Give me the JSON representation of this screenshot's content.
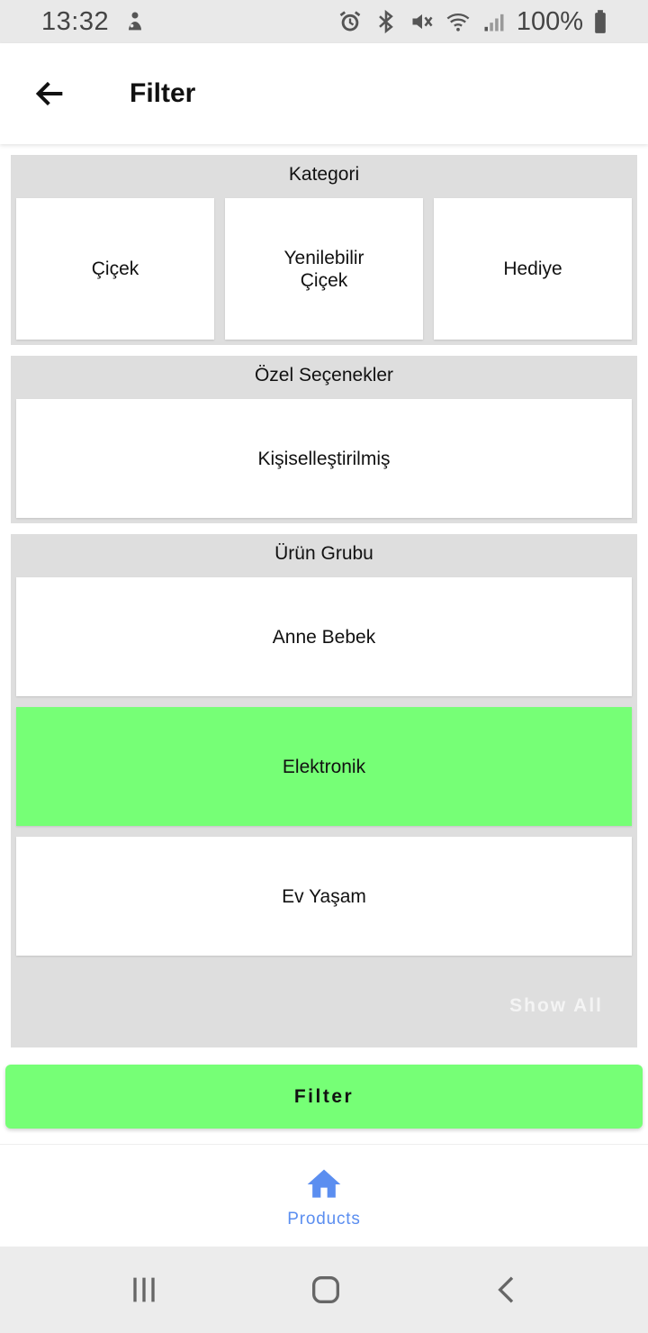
{
  "status_bar": {
    "time": "13:32",
    "battery": "100%",
    "icons": [
      "notification-icon",
      "alarm-icon",
      "bluetooth-icon",
      "vibrate-mute-icon",
      "wifi-icon",
      "signal-icon",
      "battery-icon"
    ]
  },
  "app_bar": {
    "title": "Filter",
    "back_icon": "arrow-back-icon"
  },
  "sections": {
    "kategori": {
      "title": "Kategori",
      "options": [
        "Çiçek",
        "Yenilebilir\nÇiçek",
        "Hediye"
      ]
    },
    "ozel": {
      "title": "Özel Seçenekler",
      "options": [
        "Kişiselleştirilmiş"
      ]
    },
    "urun": {
      "title": "Ürün Grubu",
      "options": [
        "Anne Bebek",
        "Elektronik",
        "Ev Yaşam"
      ],
      "selected": "Elektronik",
      "show_all": "Show All"
    }
  },
  "filter_button": {
    "label": "Filter"
  },
  "bottom_nav": {
    "items": [
      {
        "label": "Products",
        "icon": "home-icon"
      }
    ]
  },
  "system_nav": {
    "icons": [
      "recent-apps-icon",
      "home-button-icon",
      "back-nav-icon"
    ]
  },
  "colors": {
    "selected": "#76ff76",
    "section_bg": "#dedede",
    "nav_accent": "#5b8ef0"
  }
}
